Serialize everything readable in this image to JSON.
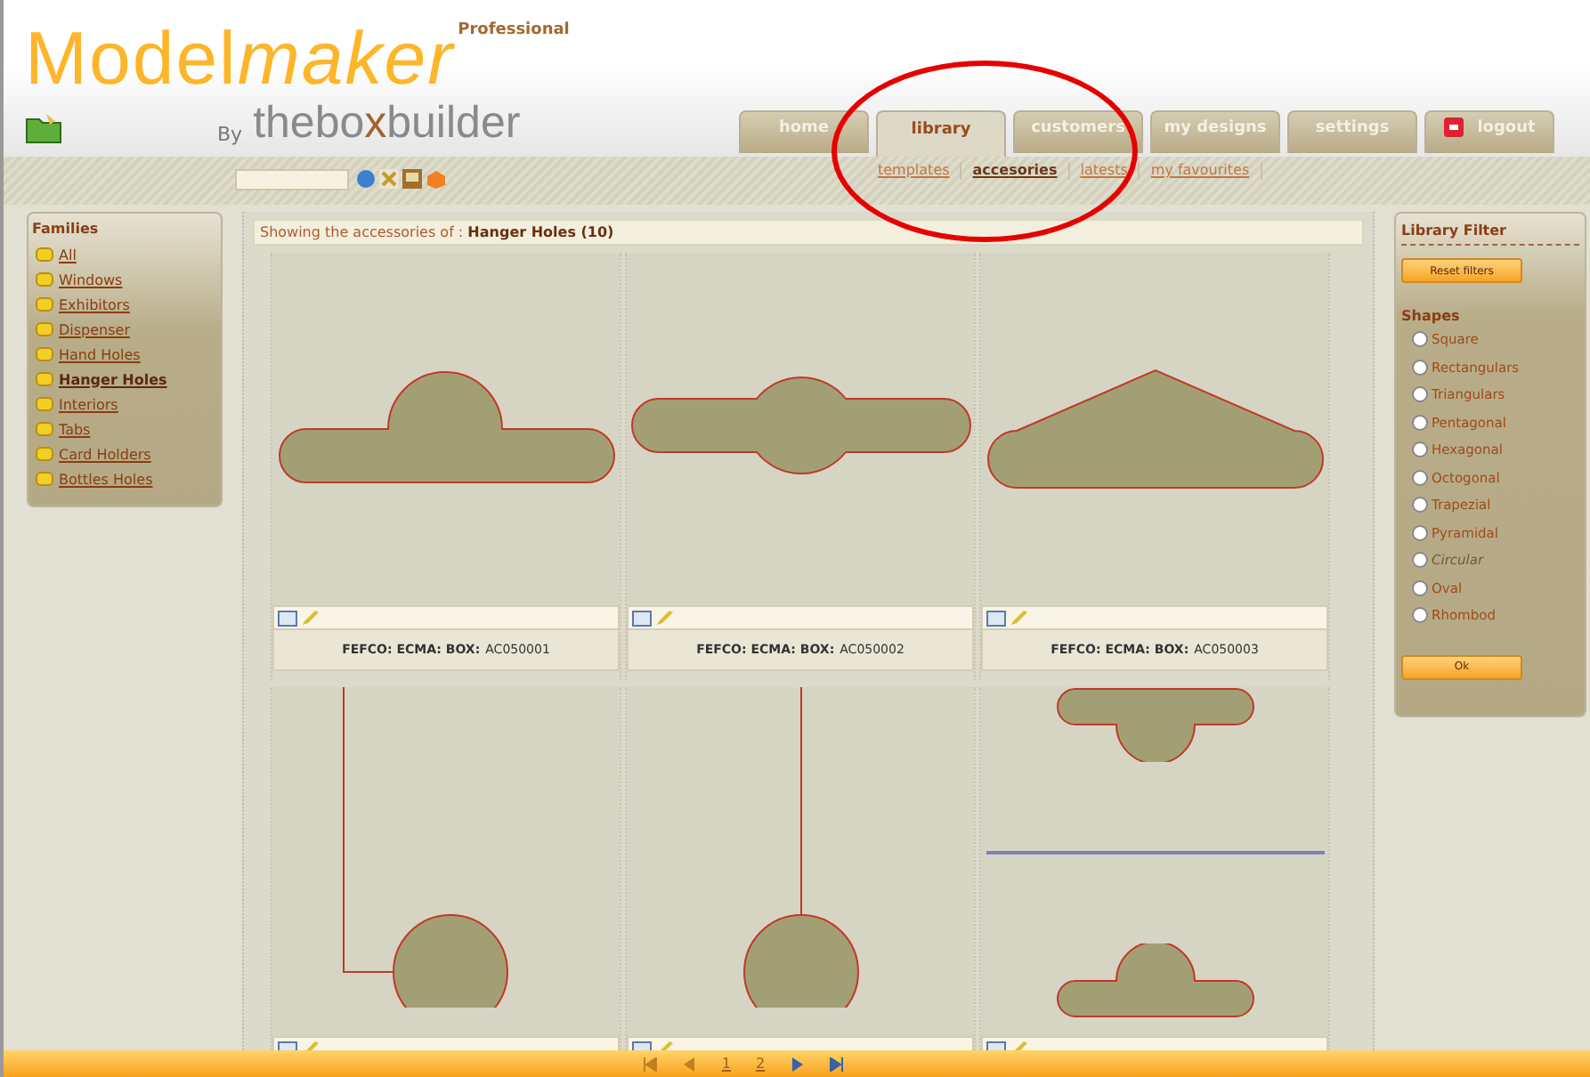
{
  "logo": {
    "title": "Model",
    "title_italic": "maker",
    "edition": "Professional",
    "byline": "By",
    "brand_a": "thebo",
    "brand_x": "x",
    "brand_b": "builder"
  },
  "tabs": [
    {
      "label": "home",
      "selected": false,
      "icon": false
    },
    {
      "label": "library",
      "selected": true,
      "icon": false
    },
    {
      "label": "customers",
      "selected": false,
      "icon": false
    },
    {
      "label": "my designs",
      "selected": false,
      "icon": false
    },
    {
      "label": "settings",
      "selected": false,
      "icon": false
    },
    {
      "label": "logout",
      "selected": false,
      "icon": true
    }
  ],
  "subnav": [
    {
      "label": "templates",
      "selected": false
    },
    {
      "label": "accesories",
      "selected": true
    },
    {
      "label": "latests",
      "selected": false
    },
    {
      "label": "my favourites",
      "selected": false
    }
  ],
  "families": {
    "title": "Families",
    "items": [
      {
        "label": "All",
        "selected": false
      },
      {
        "label": "Windows",
        "selected": false
      },
      {
        "label": "Exhibitors",
        "selected": false
      },
      {
        "label": "Dispenser",
        "selected": false
      },
      {
        "label": "Hand Holes",
        "selected": false
      },
      {
        "label": "Hanger Holes",
        "selected": true
      },
      {
        "label": "Interiors",
        "selected": false
      },
      {
        "label": "Tabs",
        "selected": false
      },
      {
        "label": "Card Holders",
        "selected": false
      },
      {
        "label": "Bottles Holes",
        "selected": false
      }
    ]
  },
  "results": {
    "heading": "Showing the accessories of : **Hanger Holes (10)**",
    "cards": [
      {
        "kind": "dome",
        "label": "FEFCO: ECMA: BOX:",
        "code": "AC050001"
      },
      {
        "kind": "circle-bar",
        "label": "FEFCO: ECMA: BOX:",
        "code": "AC050002"
      },
      {
        "kind": "triangle",
        "label": "FEFCO: ECMA: BOX:",
        "code": "AC050003"
      },
      {
        "kind": "hook-left"
      },
      {
        "kind": "hook"
      },
      {
        "kind": "double"
      }
    ]
  },
  "filter": {
    "title": "Library Filter",
    "reset": "Reset filters",
    "shapes_title": "Shapes",
    "ok": "Ok",
    "shapes": [
      {
        "label": "Square",
        "checked": false,
        "disabled": false
      },
      {
        "label": "Rectangulars",
        "checked": false,
        "disabled": false
      },
      {
        "label": "Triangulars",
        "checked": false,
        "disabled": false
      },
      {
        "label": "Pentagonal",
        "checked": false,
        "disabled": false
      },
      {
        "label": "Hexagonal",
        "checked": false,
        "disabled": false
      },
      {
        "label": "Octogonal",
        "checked": false,
        "disabled": false
      },
      {
        "label": "Trapezial",
        "checked": false,
        "disabled": false
      },
      {
        "label": "Pyramidal",
        "checked": false,
        "disabled": false
      },
      {
        "label": "Circular",
        "checked": false,
        "disabled": true
      },
      {
        "label": "Oval",
        "checked": false,
        "disabled": false
      },
      {
        "label": "Rhombod",
        "checked": false,
        "disabled": false
      }
    ]
  },
  "pager": [
    "1",
    "2"
  ]
}
